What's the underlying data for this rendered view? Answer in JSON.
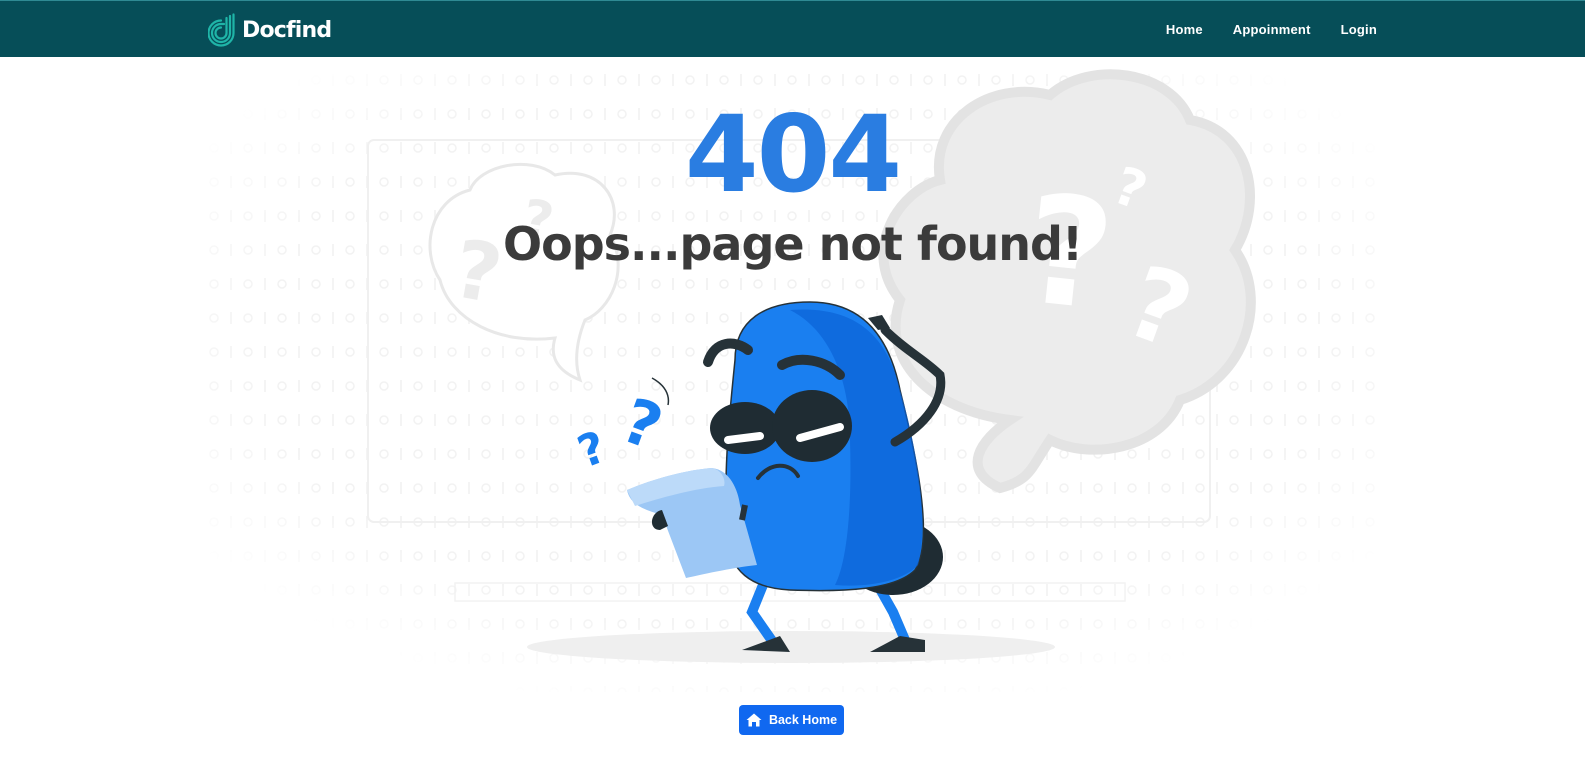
{
  "navbar": {
    "brand": "Docfind",
    "links": [
      "Home",
      "Appoinment",
      "Login"
    ]
  },
  "error": {
    "code": "404",
    "message": "Oops...page not found!"
  },
  "actions": {
    "back_home_label": "Back Home",
    "back_home_icon": "home-icon"
  },
  "colors": {
    "navbar_bg": "#064e58",
    "accent_blue": "#2a7de1",
    "button_blue": "#1068f0",
    "message_text": "#3b3b3b"
  }
}
